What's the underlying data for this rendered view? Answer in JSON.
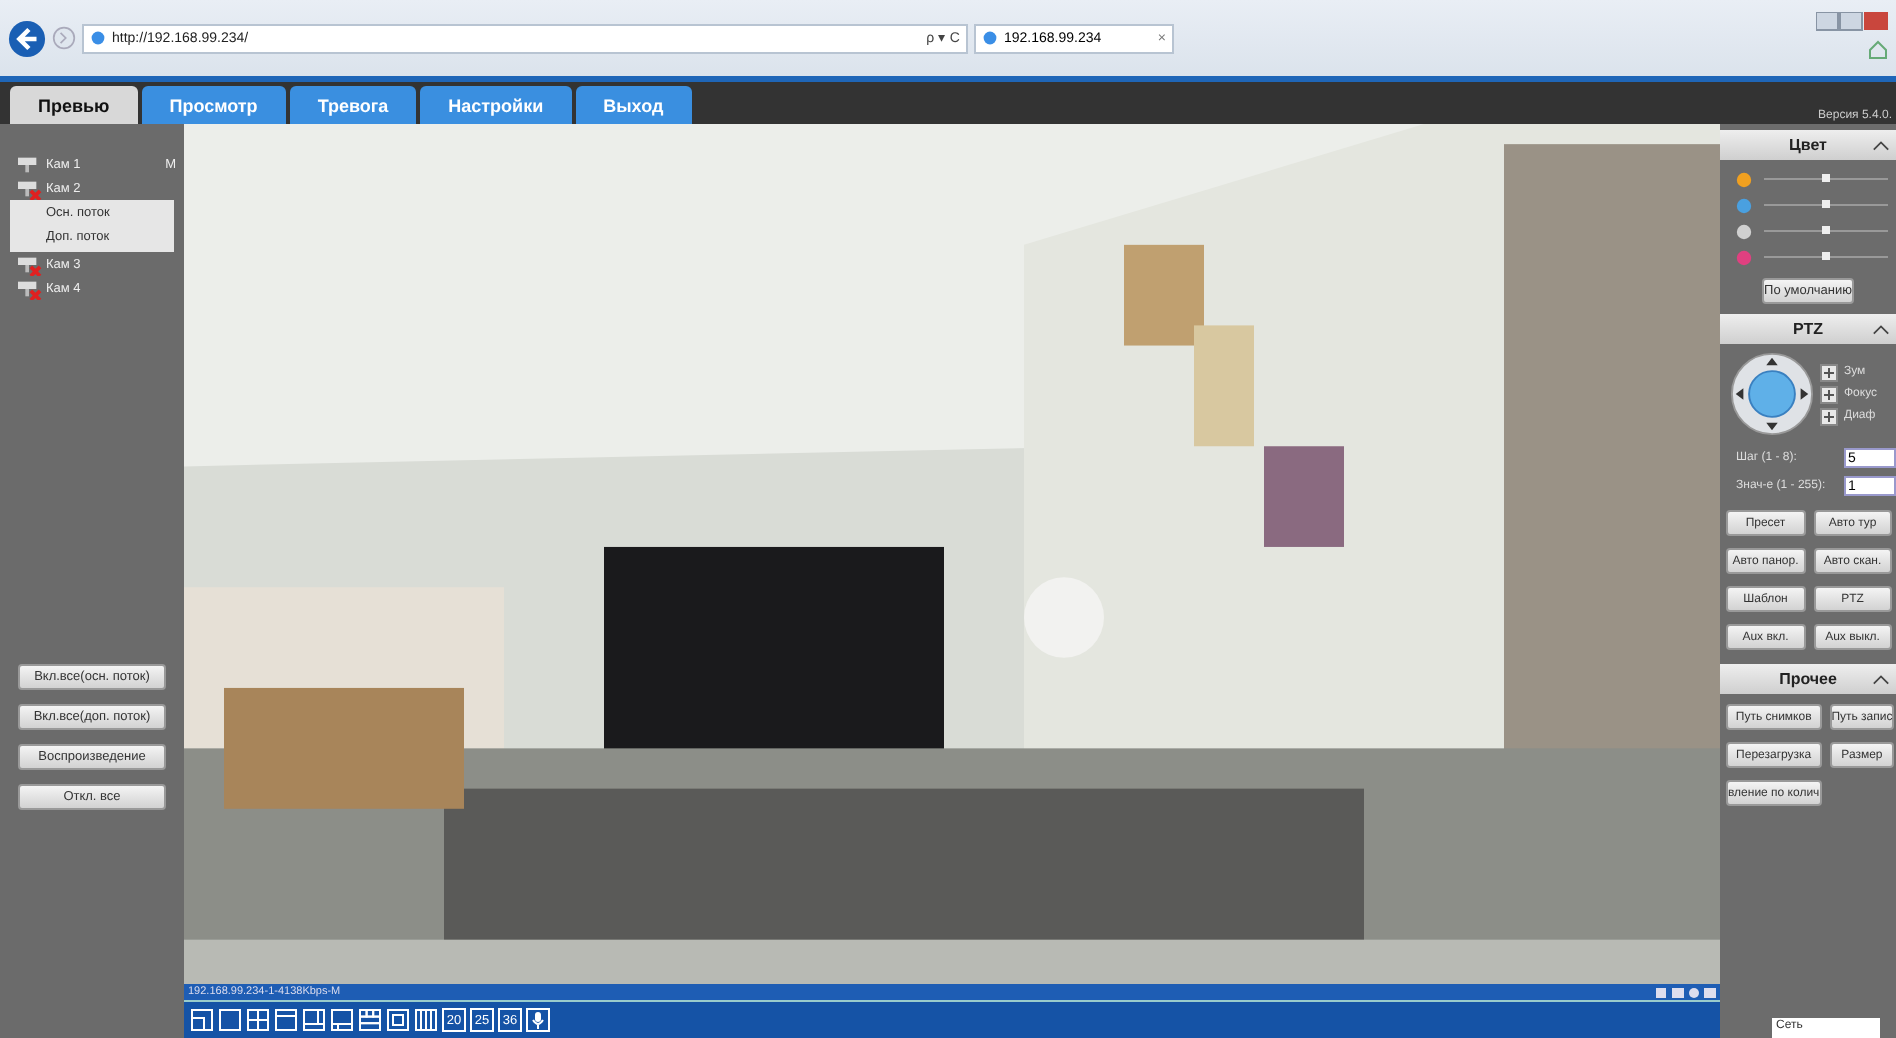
{
  "browser": {
    "address": "http://192.168.99.234/",
    "search_controls": "ρ ▾ C",
    "tab": {
      "title": "192.168.99.234",
      "close": "×"
    }
  },
  "tabs": [
    {
      "label": "Превью",
      "selected": true
    },
    {
      "label": "Просмотр",
      "selected": false
    },
    {
      "label": "Тревога",
      "selected": false
    },
    {
      "label": "Настройки",
      "selected": false
    },
    {
      "label": "Выход",
      "selected": false
    }
  ],
  "version": "Версия 5.4.0.",
  "cameras": [
    {
      "name": "Кам 1",
      "connected": true,
      "badge": "M"
    },
    {
      "name": "Кам 2",
      "connected": false,
      "menu": [
        "Осн. поток",
        "Доп. поток"
      ]
    },
    {
      "name": "Кам 3",
      "connected": false
    },
    {
      "name": "Кам 4",
      "connected": false
    }
  ],
  "left_buttons": [
    "Вкл.все(осн. поток)",
    "Вкл.все(доп. поток)",
    "Воспроизведение",
    "Откл. все"
  ],
  "video": {
    "status": "192.168.99.234-1-4138Kbps-M"
  },
  "layout_buttons": [
    {
      "kind": "grid"
    },
    {
      "kind": "grid"
    },
    {
      "kind": "grid"
    },
    {
      "kind": "grid"
    },
    {
      "kind": "grid"
    },
    {
      "kind": "grid"
    },
    {
      "kind": "grid"
    },
    {
      "kind": "grid"
    },
    {
      "kind": "grid"
    },
    {
      "kind": "text",
      "label": "20"
    },
    {
      "kind": "text",
      "label": "25"
    },
    {
      "kind": "text",
      "label": "36"
    },
    {
      "kind": "mic"
    }
  ],
  "color_panel": {
    "title": "Цвет",
    "sliders": [
      {
        "kind": "brightness",
        "level": 0.5
      },
      {
        "kind": "contrast",
        "level": 0.5
      },
      {
        "kind": "saturation",
        "level": 0.5
      },
      {
        "kind": "hue",
        "level": 0.5
      }
    ],
    "default_button": "По умолчанию"
  },
  "ptz_panel": {
    "title": "PTZ",
    "controls": [
      {
        "label": "Зум"
      },
      {
        "label": "Фокус"
      },
      {
        "label": "Диаф"
      }
    ],
    "fields": [
      {
        "label": "Шаг (1 - 8):",
        "value": "5"
      },
      {
        "label": "Знач-е (1 - 255):",
        "value": "1"
      }
    ],
    "buttons": [
      "Пресет",
      "Авто тур",
      "Авто панор.",
      "Авто скан.",
      "Шаблон",
      "PTZ",
      "Aux вкл.",
      "Aux выкл."
    ]
  },
  "other_panel": {
    "title": "Прочее",
    "buttons": [
      "Путь снимков",
      "Путь запис",
      "Перезагрузка",
      "Размер",
      "вление по колич"
    ]
  },
  "tooltip": "Сеть"
}
